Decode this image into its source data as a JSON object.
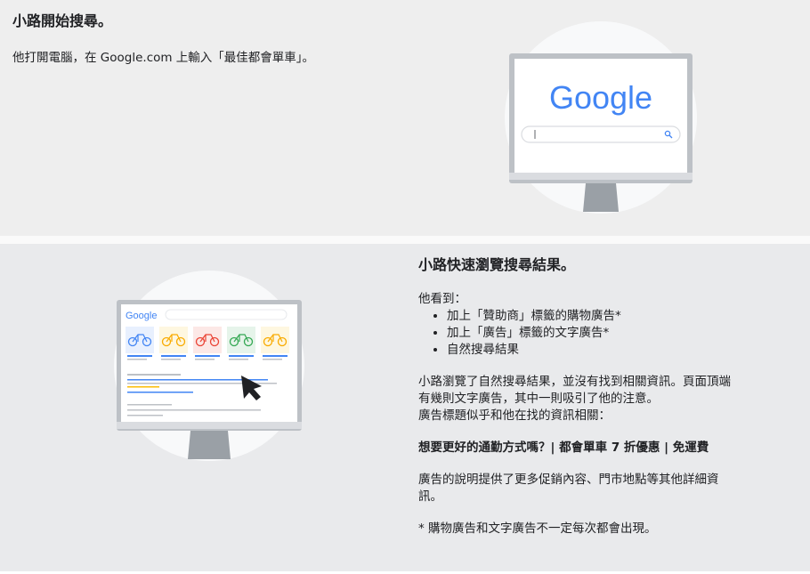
{
  "section1": {
    "title": "小路開始搜尋。",
    "text": "他打開電腦，在 Google.com 上輸入「最佳都會單車」。",
    "logo": "Google",
    "search_icon": "search-icon"
  },
  "section2": {
    "title": "小路快速瀏覽搜尋結果。",
    "intro": "他看到：",
    "bullets": [
      "加上「贊助商」標籤的購物廣告*",
      "加上「廣告」標籤的文字廣告*",
      "自然搜尋結果"
    ],
    "para1_line1": "小路瀏覽了自然搜尋結果，並沒有找到相關資訊。頁面頂端",
    "para1_line2": "有幾則文字廣告，其中一則吸引了他的注意。",
    "para1_line3": "廣告標題似乎和他在找的資訊相關：",
    "ad_headline": "想要更好的通勤方式嗎？| 都會單車 7 折優惠 | 免運費",
    "para2_line1": "廣告的說明提供了更多促銷內容、門市地點等其他詳細資",
    "para2_line2": "訊。",
    "footnote": "* 購物廣告和文字廣告不一定每次都會出現。",
    "logo": "Google"
  },
  "colors": {
    "google_blue": "#4285f4",
    "google_red": "#ea4335",
    "google_yellow": "#fbbc05",
    "google_green": "#34a853"
  }
}
